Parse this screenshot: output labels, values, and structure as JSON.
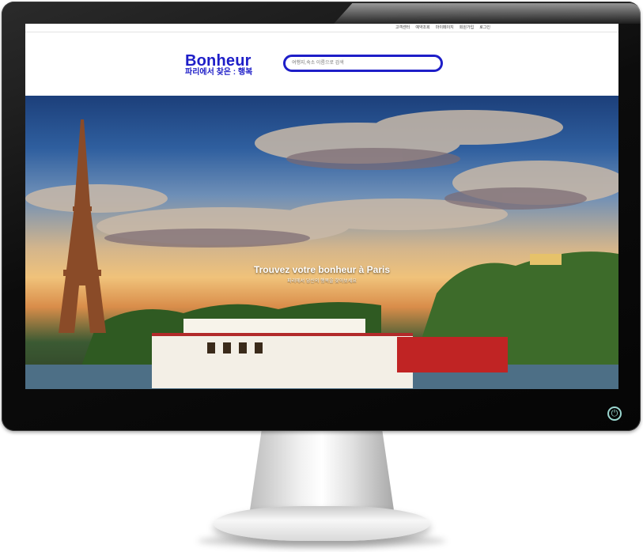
{
  "util_links": [
    "고객센터",
    "예약조회",
    "마이페이지",
    "회원가입",
    "로그인"
  ],
  "logo": {
    "title": "Bonheur",
    "subtitle": "파리에서 찾은 : 행복"
  },
  "search": {
    "placeholder": "여행지,숙소 이름으로 검색"
  },
  "hero": {
    "title": "Trouvez votre bonheur à Paris",
    "subtitle": "파리에서 당신의 행복을 찾아보세요"
  },
  "colors": {
    "brand": "#1e1ec8"
  },
  "icons": {
    "power": "power-icon"
  }
}
